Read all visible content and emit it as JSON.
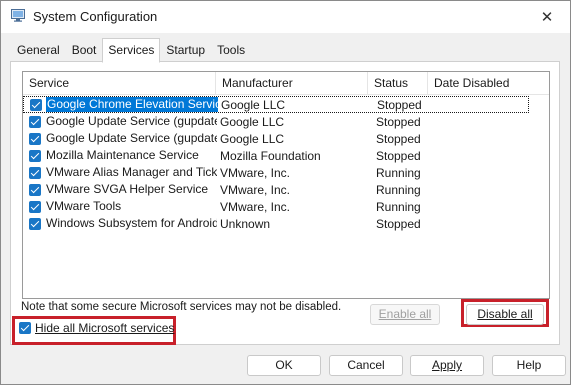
{
  "window": {
    "title": "System Configuration",
    "close_glyph": "✕"
  },
  "tabs": [
    {
      "label": "General"
    },
    {
      "label": "Boot"
    },
    {
      "label": "Services"
    },
    {
      "label": "Startup"
    },
    {
      "label": "Tools"
    }
  ],
  "active_tab": "Services",
  "table": {
    "columns": [
      "Service",
      "Manufacturer",
      "Status",
      "Date Disabled"
    ],
    "rows": [
      {
        "checked": true,
        "service": "Google Chrome Elevation Servic...",
        "manufacturer": "Google LLC",
        "status": "Stopped",
        "date_disabled": "",
        "selected": true
      },
      {
        "checked": true,
        "service": "Google Update Service (gupdate)",
        "manufacturer": "Google LLC",
        "status": "Stopped",
        "date_disabled": ""
      },
      {
        "checked": true,
        "service": "Google Update Service (gupdatem)",
        "manufacturer": "Google LLC",
        "status": "Stopped",
        "date_disabled": ""
      },
      {
        "checked": true,
        "service": "Mozilla Maintenance Service",
        "manufacturer": "Mozilla Foundation",
        "status": "Stopped",
        "date_disabled": ""
      },
      {
        "checked": true,
        "service": "VMware Alias Manager and Ticke...",
        "manufacturer": "VMware, Inc.",
        "status": "Running",
        "date_disabled": ""
      },
      {
        "checked": true,
        "service": "VMware SVGA Helper Service",
        "manufacturer": "VMware, Inc.",
        "status": "Running",
        "date_disabled": ""
      },
      {
        "checked": true,
        "service": "VMware Tools",
        "manufacturer": "VMware, Inc.",
        "status": "Running",
        "date_disabled": ""
      },
      {
        "checked": true,
        "service": "Windows Subsystem for Android™",
        "manufacturer": "Unknown",
        "status": "Stopped",
        "date_disabled": ""
      }
    ]
  },
  "note": "Note that some secure Microsoft services may not be disabled.",
  "buttons": {
    "enable_all": "Enable all",
    "disable_all": "Disable all",
    "ok": "OK",
    "cancel": "Cancel",
    "apply": "Apply",
    "help": "Help"
  },
  "hide_ms": {
    "checked": true,
    "label": "Hide all Microsoft services"
  },
  "colors": {
    "highlight": "#c8202a",
    "selection": "#0078d7",
    "checkbox": "#1976c6"
  }
}
